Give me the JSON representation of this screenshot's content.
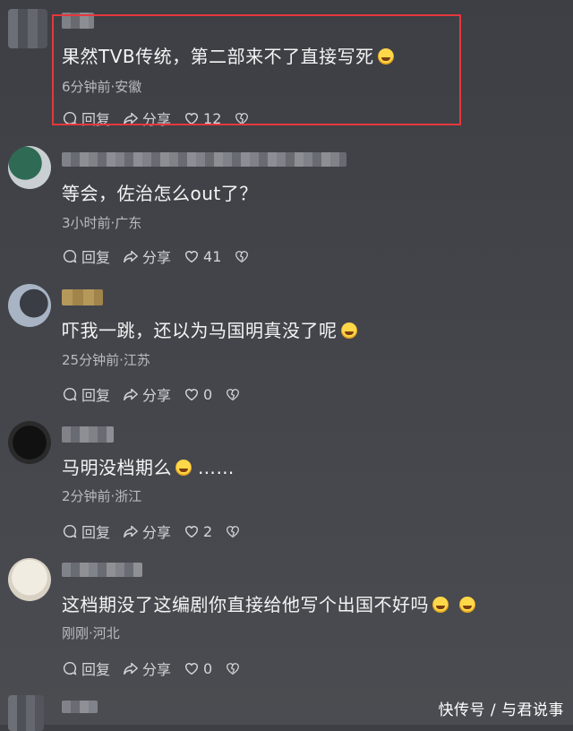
{
  "comments": [
    {
      "text": "果然TVB传统，第二部来不了直接写死",
      "emoji_count": 1,
      "meta": "6分钟前·安徽",
      "actions": {
        "reply": "回复",
        "share": "分享",
        "likes": "12"
      }
    },
    {
      "text": "等会，佐治怎么out了？",
      "emoji_count": 0,
      "meta": "3小时前·广东",
      "actions": {
        "reply": "回复",
        "share": "分享",
        "likes": "41"
      }
    },
    {
      "text": "吓我一跳，还以为马国明真没了呢",
      "emoji_count": 1,
      "meta": "25分钟前·江苏",
      "actions": {
        "reply": "回复",
        "share": "分享",
        "likes": "0"
      }
    },
    {
      "text": "马明没档期么",
      "text_suffix": " ……",
      "emoji_count": 1,
      "meta": "2分钟前·浙江",
      "actions": {
        "reply": "回复",
        "share": "分享",
        "likes": "2"
      }
    },
    {
      "text": "这档期没了这编剧你直接给他写个出国不好吗",
      "emoji_count": 2,
      "meta": "刚刚·河北",
      "actions": {
        "reply": "回复",
        "share": "分享",
        "likes": "0"
      }
    }
  ],
  "watermark": "快传号 / 与君说事",
  "colors": {
    "highlight_border": "#e5383b",
    "background": "#3f4147"
  }
}
